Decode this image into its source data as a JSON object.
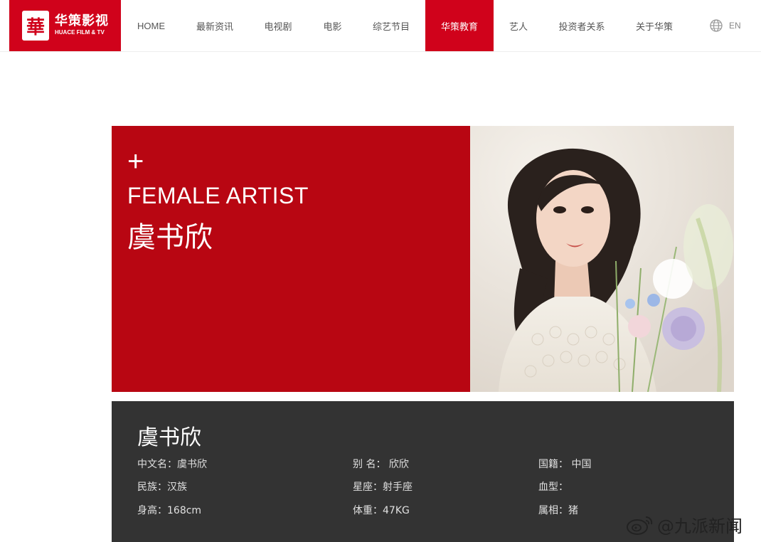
{
  "brand": {
    "name_cn": "华策影视",
    "name_en": "HUACE FILM & TV",
    "mark": "華"
  },
  "nav": [
    {
      "label": "HOME",
      "active": false
    },
    {
      "label": "最新资讯",
      "active": false
    },
    {
      "label": "电视剧",
      "active": false
    },
    {
      "label": "电影",
      "active": false
    },
    {
      "label": "综艺节目",
      "active": false
    },
    {
      "label": "华策教育",
      "active": true
    },
    {
      "label": "艺人",
      "active": false
    },
    {
      "label": "投资者关系",
      "active": false
    },
    {
      "label": "关于华策",
      "active": false
    }
  ],
  "lang": {
    "label": "EN",
    "icon": "globe-icon"
  },
  "hero": {
    "plus": "+",
    "subtitle": "FEMALE ARTIST",
    "name": "虞书欣",
    "colors": {
      "panel": "#b80612",
      "brand": "#d0021b"
    }
  },
  "profile": {
    "title": "虞书欣",
    "fields": [
      {
        "text": "中文名：虞书欣"
      },
      {
        "text": "别 名：  欣欣"
      },
      {
        "text": "国籍：  中国"
      },
      {
        "text": "民族：汉族"
      },
      {
        "text": "星座：射手座"
      },
      {
        "text": "血型："
      },
      {
        "text": "身高：168cm"
      },
      {
        "text": "体重：47KG"
      },
      {
        "text": "属相：猪"
      }
    ]
  },
  "watermark": {
    "text": "@九派新闻",
    "icon": "weibo-icon"
  }
}
